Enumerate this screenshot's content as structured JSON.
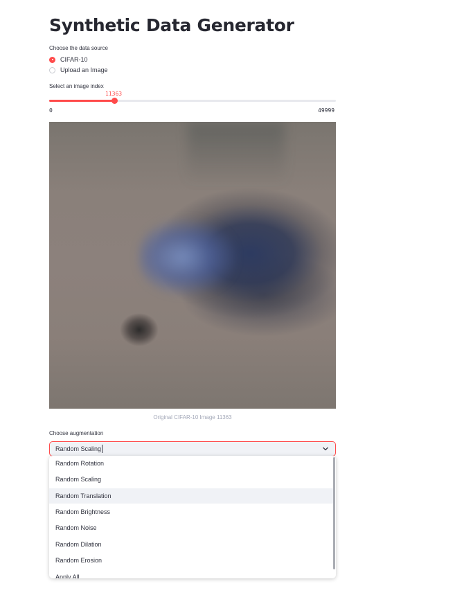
{
  "page": {
    "title": "Synthetic Data Generator"
  },
  "source": {
    "label": "Choose the data source",
    "options": [
      {
        "label": "CIFAR-10",
        "selected": true
      },
      {
        "label": "Upload an Image",
        "selected": false
      }
    ]
  },
  "slider": {
    "label": "Select an image index",
    "value": "11363",
    "min": "0",
    "max": "49999",
    "fraction": 0.227
  },
  "image": {
    "caption": "Original CIFAR-10 Image 11363",
    "icon": "cifar-image"
  },
  "augmentation": {
    "label": "Choose augmentation",
    "selected": "Random Scaling",
    "options": [
      "Random Rotation",
      "Random Scaling",
      "Random Translation",
      "Random Brightness",
      "Random Noise",
      "Random Dilation",
      "Random Erosion",
      "Apply All"
    ],
    "highlighted_index": 2
  },
  "colors": {
    "accent": "#ff4b4b",
    "text": "#31333f",
    "muted": "#a3a8b8",
    "field_bg": "#f0f2f6"
  }
}
